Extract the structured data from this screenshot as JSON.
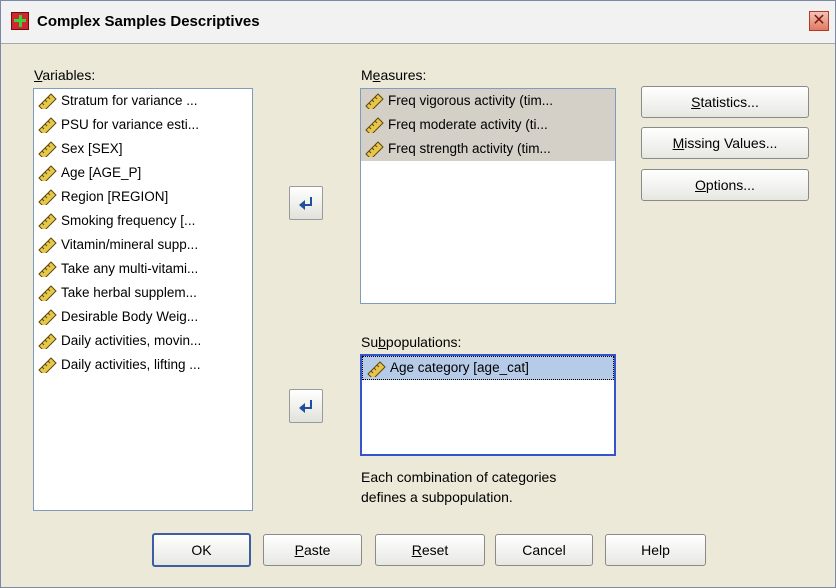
{
  "window": {
    "title": "Complex Samples Descriptives"
  },
  "variables": {
    "label_pre": "",
    "label_u": "V",
    "label_post": "ariables:",
    "items": [
      "Stratum for variance ...",
      "PSU for variance esti...",
      "Sex [SEX]",
      "Age [AGE_P]",
      "Region [REGION]",
      "Smoking frequency [...",
      "Vitamin/mineral supp...",
      "Take any multi-vitami...",
      "Take herbal supplem...",
      "Desirable Body Weig...",
      "Daily activities, movin...",
      "Daily activities, lifting ..."
    ]
  },
  "measures": {
    "label_pre": "M",
    "label_u": "e",
    "label_post": "asures:",
    "items": [
      "Freq vigorous activity (tim...",
      "Freq moderate activity (ti...",
      "Freq strength activity (tim..."
    ]
  },
  "subpopulations": {
    "label_pre": "Su",
    "label_u": "b",
    "label_post": "populations:",
    "items": [
      "Age category [age_cat]"
    ],
    "note_line1": "Each combination of categories",
    "note_line2": "defines a subpopulation."
  },
  "side_buttons": {
    "statistics": {
      "pre": "",
      "u": "S",
      "post": "tatistics..."
    },
    "missing": {
      "pre": "",
      "u": "M",
      "post": "issing Values..."
    },
    "options": {
      "pre": "",
      "u": "O",
      "post": "ptions..."
    }
  },
  "bottom_buttons": {
    "ok": "OK",
    "paste": {
      "pre": "",
      "u": "P",
      "post": "aste"
    },
    "reset": {
      "pre": "",
      "u": "R",
      "post": "eset"
    },
    "cancel": "Cancel",
    "help": "Help"
  },
  "colors": {
    "dialog_bg": "#ece9d8",
    "selection_gray": "#d4d0c8",
    "selection_blue": "#b5cbe8",
    "arrow_blue": "#1f4f9e"
  },
  "icons": {
    "variable": "scale-ruler-icon",
    "move": "move-arrow-icon"
  }
}
